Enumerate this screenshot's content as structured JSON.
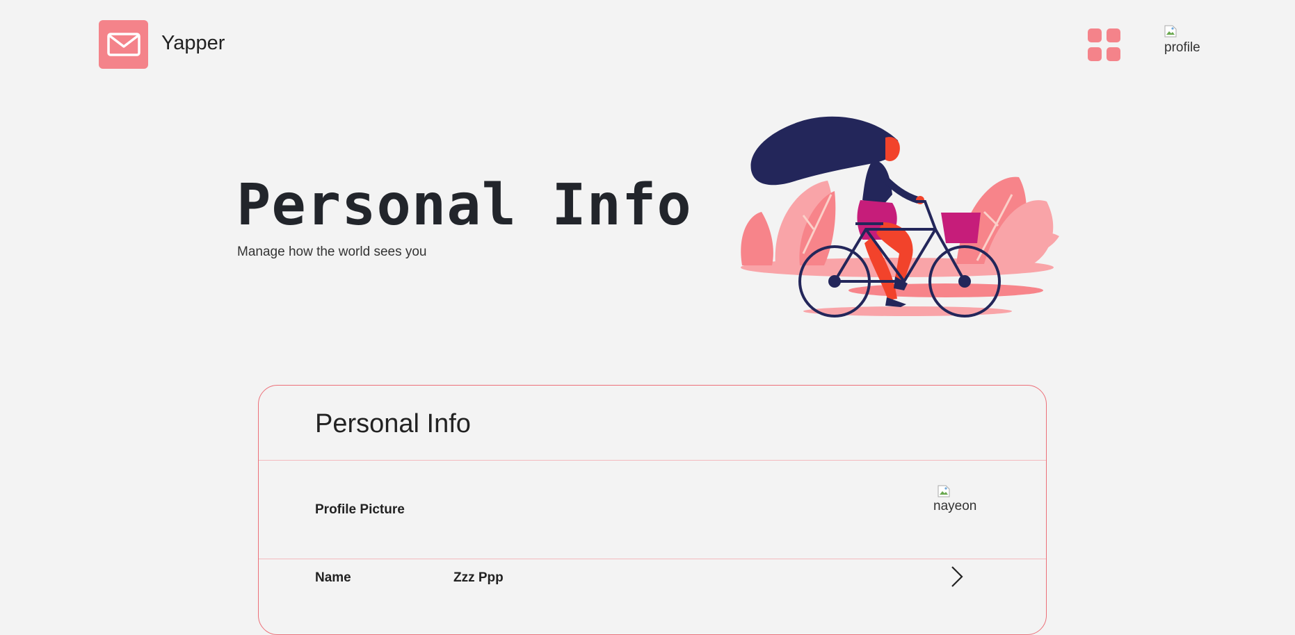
{
  "app": {
    "brand": "Yapper",
    "profile_alt": "profile"
  },
  "hero": {
    "title": "Personal Info",
    "subtitle": "Manage how the world sees you"
  },
  "card": {
    "title": "Personal Info",
    "rows": [
      {
        "label": "Profile Picture",
        "image_alt": "nayeon"
      },
      {
        "label": "Name",
        "value": "Zzz Ppp"
      }
    ]
  },
  "colors": {
    "accent": "#f4838a",
    "card_border": "#ec6f78",
    "background": "#f3f3f3",
    "text": "#222222"
  },
  "icons": {
    "logo": "mail-envelope-icon",
    "apps": "apps-grid-icon",
    "row_action": "chevron-right-icon"
  }
}
